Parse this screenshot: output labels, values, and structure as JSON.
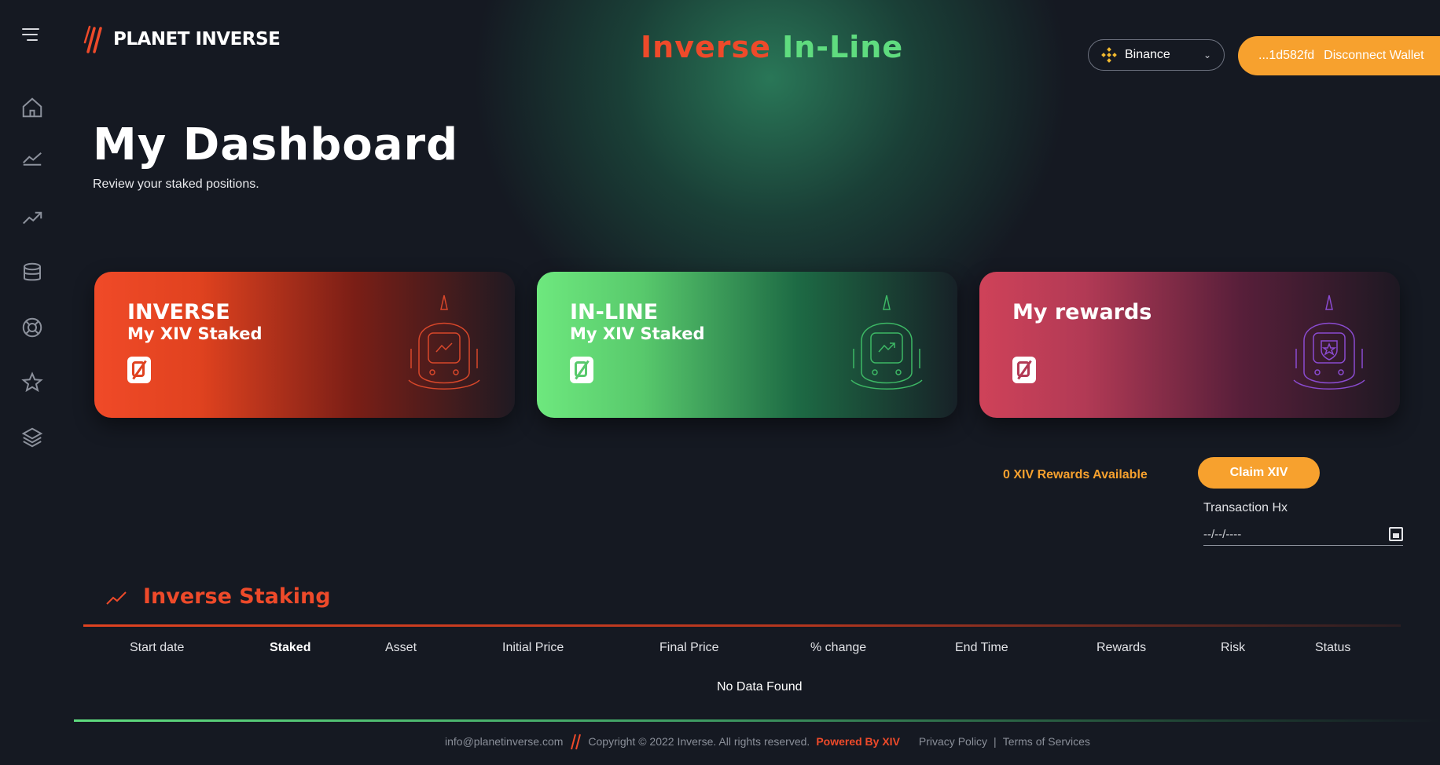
{
  "header": {
    "logo_text": "PLANET INVERSE",
    "brand_part1": "Inverse",
    "brand_part2": "In-Line",
    "network_label": "Binance",
    "wallet_address": "...1d582fd",
    "wallet_action": "Disconnect Wallet"
  },
  "sidebar": {
    "items": [
      "home-icon",
      "trend-down-chart-icon",
      "trend-up-chart-icon",
      "database-icon",
      "lifebuoy-icon",
      "star-icon",
      "layers-icon"
    ]
  },
  "page": {
    "title": "My Dashboard",
    "subtitle": "Review your staked positions."
  },
  "cards": [
    {
      "title": "INVERSE",
      "subtitle": "My XIV Staked",
      "value": "0"
    },
    {
      "title": "IN-LINE",
      "subtitle": "My XIV Staked",
      "value": "0"
    },
    {
      "title": "My rewards",
      "subtitle": "",
      "value": "0"
    }
  ],
  "rewards": {
    "available_text": "0 XIV Rewards Available",
    "claim_label": "Claim XIV"
  },
  "transactions": {
    "label": "Transaction Hx",
    "date_placeholder": "--/--/----"
  },
  "table": {
    "section_title": "Inverse Staking",
    "columns": [
      "Start date",
      "Staked",
      "Asset",
      "Initial Price",
      "Final Price",
      "% change",
      "End Time",
      "Rewards",
      "Risk",
      "Status"
    ],
    "empty_text": "No Data Found"
  },
  "footer": {
    "email": "info@planetinverse.com",
    "copyright": "Copyright © 2022 Inverse. All rights reserved.",
    "powered": "Powered By XIV",
    "privacy": "Privacy Policy",
    "separator": "|",
    "terms": "Terms of Services"
  },
  "colors": {
    "background": "#151922",
    "accent_orange": "#f7a12e",
    "inverse_red": "#ee4a2a",
    "inline_green": "#5fdc7f",
    "rewards_pink": "#cf4259"
  }
}
